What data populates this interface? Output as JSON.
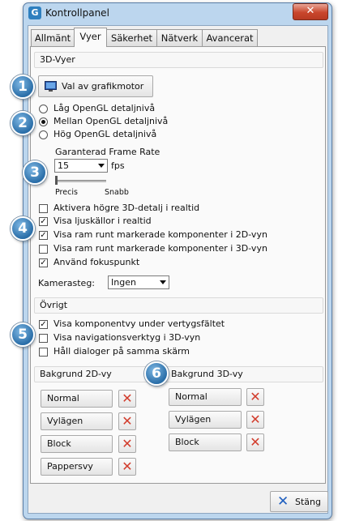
{
  "window": {
    "title": "Kontrollpanel",
    "close_glyph": "✕",
    "app_icon": "G"
  },
  "tabs": [
    "Allmänt",
    "Vyer",
    "Säkerhet",
    "Nätverk",
    "Avancerat"
  ],
  "active_tab": "Vyer",
  "views3d": {
    "section_title": "3D-Vyer",
    "engine_button": "Val av grafikmotor",
    "detail_levels": [
      {
        "label": "Låg OpenGL detaljnivå",
        "selected": false
      },
      {
        "label": "Mellan OpenGL detaljnivå",
        "selected": true
      },
      {
        "label": "Hög OpenGL detaljnivå",
        "selected": false
      }
    ],
    "frame_rate_label": "Garanterad Frame Rate",
    "frame_rate_value": "15",
    "frame_rate_unit": "fps",
    "slider_left": "Precis",
    "slider_right": "Snabb",
    "slider_level": 0.0,
    "options": [
      {
        "label": "Aktivera högre 3D-detalj i realtid",
        "checked": false
      },
      {
        "label": "Visa ljuskällor i realtid",
        "checked": true
      },
      {
        "label": "Visa ram runt markerade komponenter i 2D-vyn",
        "checked": true
      },
      {
        "label": "Visa ram runt markerade komponenter i 3D-vyn",
        "checked": false
      },
      {
        "label": "Använd fokuspunkt",
        "checked": true
      }
    ],
    "camera_label": "Kamerasteg:",
    "camera_value": "Ingen"
  },
  "other": {
    "section_title": "Övrigt",
    "options": [
      {
        "label": "Visa komponentvy under vertygsfältet",
        "checked": true
      },
      {
        "label": "Visa navigationsverktyg i 3D-vyn",
        "checked": false
      },
      {
        "label": "Håll dialoger på samma skärm",
        "checked": false
      }
    ]
  },
  "backgrounds": {
    "bg2d_title": "Bakgrund 2D-vy",
    "bg3d_title": "Bakgrund 3D-vy",
    "bg2d_items": [
      "Normal",
      "Vylägen",
      "Block",
      "Pappersvy"
    ],
    "bg3d_items": [
      "Normal",
      "Vylägen",
      "Block"
    ],
    "delete_glyph": "✕"
  },
  "footer": {
    "close_button": "Stäng",
    "close_icon": "✕"
  },
  "callouts": [
    "1",
    "2",
    "3",
    "4",
    "5",
    "6"
  ],
  "colors": {
    "accent": "#2a6ea8",
    "delete": "#d23c2c",
    "window_frame": "#bcd6ee"
  }
}
